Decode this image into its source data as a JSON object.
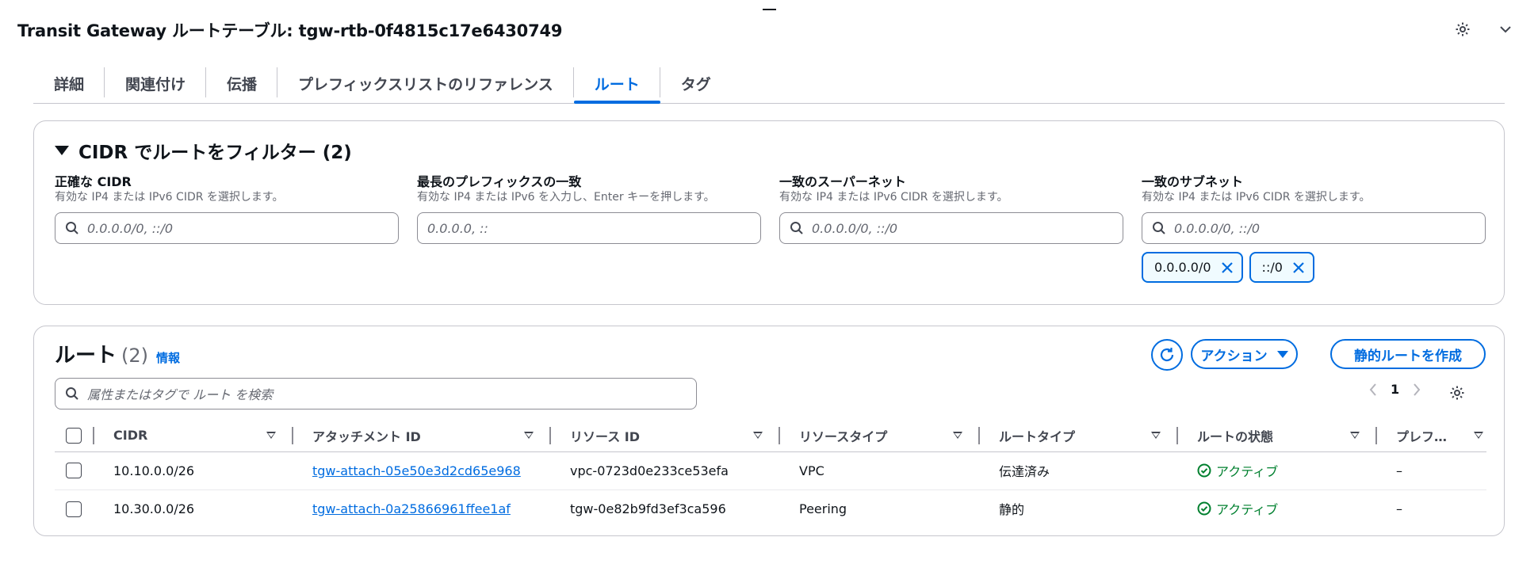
{
  "header": {
    "title": "Transit Gateway ルートテーブル: tgw-rtb-0f4815c17e6430749"
  },
  "tabs": [
    {
      "label": "詳細"
    },
    {
      "label": "関連付け"
    },
    {
      "label": "伝播"
    },
    {
      "label": "プレフィックスリストのリファレンス"
    },
    {
      "label": "ルート",
      "active": true
    },
    {
      "label": "タグ"
    }
  ],
  "filter": {
    "title": "CIDR でルートをフィルター (2)",
    "groups": [
      {
        "label": "正確な CIDR",
        "description": "有効な IP4 または IPv6 CIDR を選択します。",
        "placeholder": "0.0.0.0/0, ::/0"
      },
      {
        "label": "最長のプレフィックスの一致",
        "description": "有効な IP4 または IPv6 を入力し、Enter キーを押します。",
        "placeholder": "0.0.0.0, ::"
      },
      {
        "label": "一致のスーパーネット",
        "description": "有効な IP4 または IPv6 CIDR を選択します。",
        "placeholder": "0.0.0.0/0, ::/0"
      },
      {
        "label": "一致のサブネット",
        "description": "有効な IP4 または IPv6 CIDR を選択します。",
        "placeholder": "0.0.0.0/0, ::/0"
      }
    ],
    "tokens": [
      "0.0.0.0/0",
      "::/0"
    ]
  },
  "routes": {
    "title": "ルート",
    "count": "(2)",
    "info": "情報",
    "actions_label": "アクション",
    "create_label": "静的ルートを作成",
    "search_placeholder": "属性またはタグで ルート を検索",
    "page": "1",
    "columns": [
      "CIDR",
      "アタッチメント ID",
      "リソース ID",
      "リソースタイプ",
      "ルートタイプ",
      "ルートの状態",
      "プレフ…"
    ],
    "rows": [
      {
        "cidr": "10.10.0.0/26",
        "attachment": "tgw-attach-05e50e3d2cd65e968",
        "resource_id": "vpc-0723d0e233ce53efa",
        "resource_type": "VPC",
        "route_type": "伝達済み",
        "state": "アクティブ",
        "prefix": "–"
      },
      {
        "cidr": "10.30.0.0/26",
        "attachment": "tgw-attach-0a25866961ffee1af",
        "resource_id": "tgw-0e82b9fd3ef3ca596",
        "resource_type": "Peering",
        "route_type": "静的",
        "state": "アクティブ",
        "prefix": "–"
      }
    ]
  },
  "colors": {
    "accent": "#006ce0",
    "success": "#00802f",
    "text": "#0f141a",
    "muted": "#656871"
  }
}
